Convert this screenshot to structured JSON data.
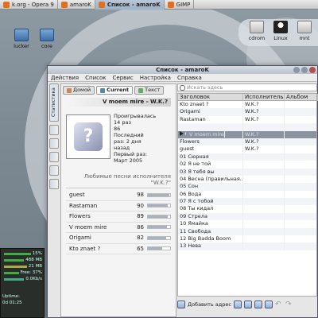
{
  "taskbar": {
    "items": [
      {
        "label": "k.org - Opera 9",
        "active": false
      },
      {
        "label": "amaroK",
        "active": false
      },
      {
        "label": "Список - amaroK",
        "active": true
      },
      {
        "label": "GIMP",
        "active": false
      }
    ]
  },
  "desktop": {
    "icons": [
      {
        "label": "lucker",
        "kind": "folder"
      },
      {
        "label": "core",
        "kind": "folder"
      },
      {
        "label": "cdrom",
        "kind": "drive"
      },
      {
        "label": "Linux",
        "kind": "tux"
      },
      {
        "label": "mnt",
        "kind": "drive"
      }
    ]
  },
  "monitor": {
    "rows": [
      "15%",
      "488 MB",
      "21 MB",
      "Free: 37%",
      "0.0Kb/s",
      "Uptime:",
      "0d 01:25"
    ]
  },
  "window": {
    "title": "Список - amaroK",
    "menu": [
      "Действия",
      "Список",
      "Сервис",
      "Настройка",
      "Справка"
    ]
  },
  "sidebar": {
    "tabs_label": "Статистика"
  },
  "context": {
    "tabs": [
      "Домой",
      "Current",
      "Текст"
    ],
    "header": "V moem mire - W.K.?",
    "stats": [
      "Проигрывалась",
      "14 раз",
      "86",
      "Последний",
      "раз: 2 дня",
      "назад",
      "Первый раз:",
      "Март 2005"
    ],
    "fav_header": "Любимые песни исполнителя \"W.K.?\"",
    "favorites": [
      {
        "title": "guest",
        "score": 98,
        "fraction": 0.98
      },
      {
        "title": "Rastaman",
        "score": 90,
        "fraction": 0.9
      },
      {
        "title": "Flowers",
        "score": 89,
        "fraction": 0.89
      },
      {
        "title": "V moem mire",
        "score": 86,
        "fraction": 0.86
      },
      {
        "title": "Origami",
        "score": 82,
        "fraction": 0.82
      },
      {
        "title": "Kto znaet ?",
        "score": 65,
        "fraction": 0.65
      }
    ]
  },
  "playlist": {
    "search_placeholder": "Искать здесь",
    "columns": [
      "Заголовок",
      "Исполнитель",
      "Альбом"
    ],
    "rows": [
      {
        "title": "Kto znaet ?",
        "artist": "W.K.?",
        "album": "",
        "playing": false
      },
      {
        "title": "Origami",
        "artist": "W.K.?",
        "album": "",
        "playing": false
      },
      {
        "title": "Rastaman",
        "artist": "W.K.?",
        "album": "",
        "playing": false
      },
      {
        "title": "",
        "artist": "",
        "album": "",
        "playing": false
      },
      {
        "title": "V moem mire",
        "artist": "W.K.?",
        "album": "",
        "playing": true
      },
      {
        "title": "Flowers",
        "artist": "W.K.?",
        "album": "",
        "playing": false
      },
      {
        "title": "guest",
        "artist": "W.K.?",
        "album": "",
        "playing": false
      },
      {
        "title": "01 Сюрная",
        "artist": "",
        "album": "",
        "playing": false
      },
      {
        "title": "02 Я не той",
        "artist": "",
        "album": "",
        "playing": false
      },
      {
        "title": "03 Я тебя вы",
        "artist": "",
        "album": "",
        "playing": false
      },
      {
        "title": "04 Весна (правильная...",
        "artist": "",
        "album": "",
        "playing": false
      },
      {
        "title": "05 Сон",
        "artist": "",
        "album": "",
        "playing": false
      },
      {
        "title": "06 Вода",
        "artist": "",
        "album": "",
        "playing": false
      },
      {
        "title": "07 Я с тобой",
        "artist": "",
        "album": "",
        "playing": false
      },
      {
        "title": "08 Ты кидал",
        "artist": "",
        "album": "",
        "playing": false
      },
      {
        "title": "09 Стрела",
        "artist": "",
        "album": "",
        "playing": false
      },
      {
        "title": "10 Ямайка",
        "artist": "",
        "album": "",
        "playing": false
      },
      {
        "title": "11 Свобода",
        "artist": "",
        "album": "",
        "playing": false
      },
      {
        "title": "12 Big Badda Boom",
        "artist": "",
        "album": "",
        "playing": false
      },
      {
        "title": "13 Нева",
        "artist": "",
        "album": "",
        "playing": false
      }
    ],
    "add_label": "Добавить адрес"
  }
}
